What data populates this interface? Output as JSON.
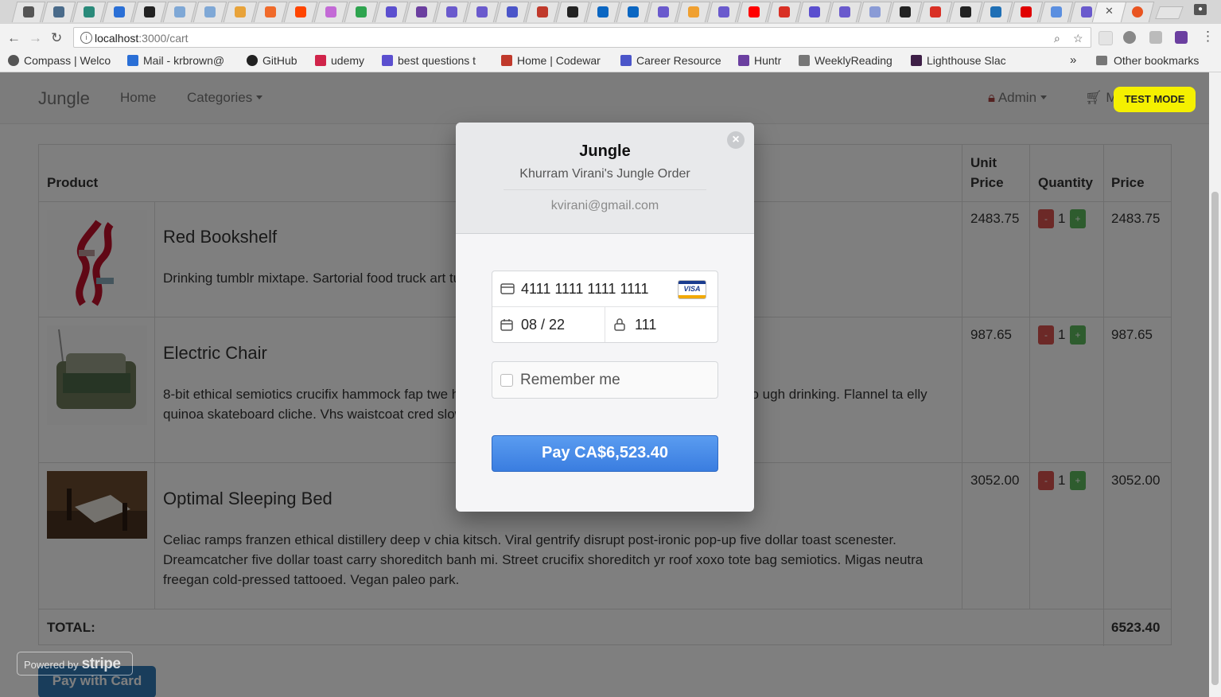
{
  "browser": {
    "url_host": "localhost",
    "url_path": ":3000/cart",
    "bookmarks": [
      {
        "label": "Compass | Welco",
        "color": "#555555"
      },
      {
        "label": "Mail - krbrown@",
        "color": "#2a6fd6"
      },
      {
        "label": "GitHub",
        "color": "#222222"
      },
      {
        "label": "udemy",
        "color": "#d0244a"
      },
      {
        "label": "best questions t",
        "color": "#5b4fcf"
      },
      {
        "label": "Home | Codewar",
        "color": "#c0392b"
      },
      {
        "label": "Career Resource",
        "color": "#4b55c9"
      },
      {
        "label": "Huntr",
        "color": "#6b3fa0"
      },
      {
        "label": "WeeklyReading",
        "color": "#777777"
      },
      {
        "label": "Lighthouse Slac",
        "color": "#3e1f47"
      }
    ],
    "bookmarks_more": "»",
    "other_bookmarks": "Other bookmarks"
  },
  "site": {
    "brand": "Jungle",
    "nav_home": "Home",
    "nav_categories": "Categories",
    "nav_admin": "Admin",
    "nav_cart_partial": "M",
    "test_mode": "TEST MODE"
  },
  "cart": {
    "headers": {
      "product": "Product",
      "unit_price": "Unit Price",
      "quantity": "Quantity",
      "price": "Price"
    },
    "items": [
      {
        "name": "Red Bookshelf",
        "description": "Drinking tumblr mixtape. Sartorial food truck art tumblr thundercats heirloom.",
        "unit_price": "2483.75",
        "quantity": "1",
        "price": "2483.75"
      },
      {
        "name": "Electric Chair",
        "description": "8-bit ethical semiotics crucifix hammock fap twe hambray raw denim. Single-origin coffee twee lomo ugh drinking. Flannel ta elly quinoa skateboard cliche. Vhs waistcoat cred slow-carb williamsburg drink",
        "unit_price": "987.65",
        "quantity": "1",
        "price": "987.65"
      },
      {
        "name": "Optimal Sleeping Bed",
        "description": "Celiac ramps franzen ethical distillery deep v chia kitsch. Viral gentrify disrupt post-ironic pop-up five dollar toast scenester. Dreamcatcher five dollar toast carry shoreditch banh mi. Street crucifix shoreditch yr roof xoxo tote bag semiotics. Migas neutra freegan cold-pressed tattooed. Vegan paleo park.",
        "unit_price": "3052.00",
        "quantity": "1",
        "price": "3052.00"
      }
    ],
    "minus": "-",
    "plus": "+",
    "total_label": "TOTAL:",
    "total_value": "6523.40",
    "pay_with_card": "Pay with Card"
  },
  "stripe_badge": {
    "powered_by": "Powered by",
    "brand": "stripe"
  },
  "checkout_modal": {
    "title": "Jungle",
    "subtitle": "Khurram Virani's Jungle Order",
    "email": "kvirani@gmail.com",
    "card_number": "4111 1111 1111 1111",
    "card_brand": "VISA",
    "expiry": "08 / 22",
    "cvc": "111",
    "remember_me": "Remember me",
    "pay_button": "Pay CA$6,523.40",
    "close": "×"
  },
  "colors": {
    "test_mode_bg": "#f5f000",
    "pay_button": "#3a7de0",
    "qty_minus": "#d9534f",
    "qty_plus": "#5cb85c"
  }
}
